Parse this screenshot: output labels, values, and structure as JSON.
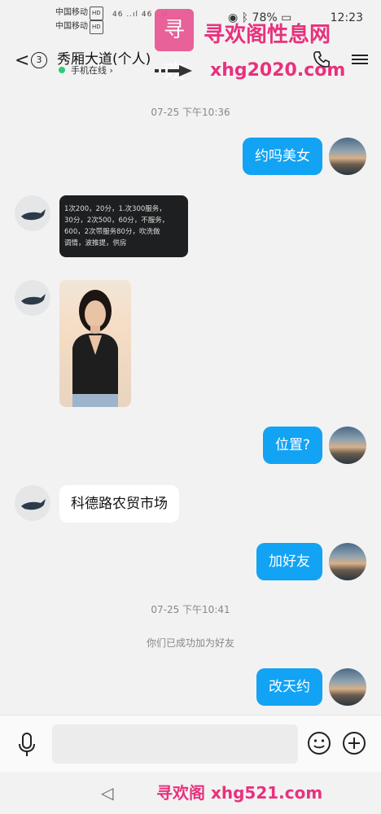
{
  "status_bar": {
    "carrier1": "中国移动",
    "carrier2": "中国移动",
    "hd": "HD",
    "signal": "46 ..ıl 46 ..ıl",
    "battery": "78%",
    "time": "12:23"
  },
  "header": {
    "back_glyph": "<",
    "unread_count": "3",
    "contact_name": "秀厢大道(个人)",
    "presence": "手机在线 ›"
  },
  "watermark": {
    "logo_char": "寻欢",
    "brand": "寻欢阁性息网",
    "domain": "xhg2020.com",
    "footer": "寻欢阁 xhg521.com"
  },
  "messages": {
    "t1": "07-25 下午10:36",
    "m1": "约吗美女",
    "price_lines": [
      "1次200，20分，1.次300服务，",
      "30分，2次500，60分，不服务，",
      "600，2次带服务80分，吹洗做",
      "调情，波推提，供房"
    ],
    "m4": "位置?",
    "m5": "科德路农贸市场",
    "m6": "加好友",
    "t2": "07-25 下午10:41",
    "system": "你们已成功加为好友",
    "m7": "改天约"
  },
  "input": {
    "placeholder": ""
  },
  "nav": {
    "back": "◁"
  },
  "colors": {
    "bubble_self": "#12a3f4",
    "watermark": "#e8317d",
    "online": "#2ecc71"
  }
}
